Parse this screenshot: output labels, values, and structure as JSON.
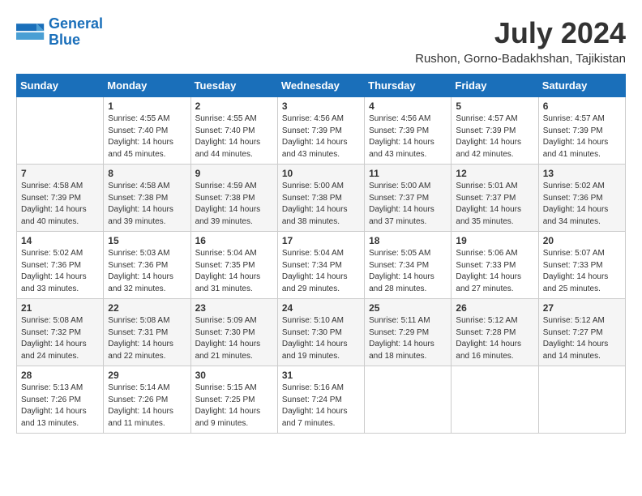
{
  "logo": {
    "line1": "General",
    "line2": "Blue"
  },
  "title": "July 2024",
  "location": "Rushon, Gorno-Badakhshan, Tajikistan",
  "headers": [
    "Sunday",
    "Monday",
    "Tuesday",
    "Wednesday",
    "Thursday",
    "Friday",
    "Saturday"
  ],
  "weeks": [
    [
      {
        "day": "",
        "sunrise": "",
        "sunset": "",
        "daylight": ""
      },
      {
        "day": "1",
        "sunrise": "Sunrise: 4:55 AM",
        "sunset": "Sunset: 7:40 PM",
        "daylight": "Daylight: 14 hours and 45 minutes."
      },
      {
        "day": "2",
        "sunrise": "Sunrise: 4:55 AM",
        "sunset": "Sunset: 7:40 PM",
        "daylight": "Daylight: 14 hours and 44 minutes."
      },
      {
        "day": "3",
        "sunrise": "Sunrise: 4:56 AM",
        "sunset": "Sunset: 7:39 PM",
        "daylight": "Daylight: 14 hours and 43 minutes."
      },
      {
        "day": "4",
        "sunrise": "Sunrise: 4:56 AM",
        "sunset": "Sunset: 7:39 PM",
        "daylight": "Daylight: 14 hours and 43 minutes."
      },
      {
        "day": "5",
        "sunrise": "Sunrise: 4:57 AM",
        "sunset": "Sunset: 7:39 PM",
        "daylight": "Daylight: 14 hours and 42 minutes."
      },
      {
        "day": "6",
        "sunrise": "Sunrise: 4:57 AM",
        "sunset": "Sunset: 7:39 PM",
        "daylight": "Daylight: 14 hours and 41 minutes."
      }
    ],
    [
      {
        "day": "7",
        "sunrise": "Sunrise: 4:58 AM",
        "sunset": "Sunset: 7:39 PM",
        "daylight": "Daylight: 14 hours and 40 minutes."
      },
      {
        "day": "8",
        "sunrise": "Sunrise: 4:58 AM",
        "sunset": "Sunset: 7:38 PM",
        "daylight": "Daylight: 14 hours and 39 minutes."
      },
      {
        "day": "9",
        "sunrise": "Sunrise: 4:59 AM",
        "sunset": "Sunset: 7:38 PM",
        "daylight": "Daylight: 14 hours and 39 minutes."
      },
      {
        "day": "10",
        "sunrise": "Sunrise: 5:00 AM",
        "sunset": "Sunset: 7:38 PM",
        "daylight": "Daylight: 14 hours and 38 minutes."
      },
      {
        "day": "11",
        "sunrise": "Sunrise: 5:00 AM",
        "sunset": "Sunset: 7:37 PM",
        "daylight": "Daylight: 14 hours and 37 minutes."
      },
      {
        "day": "12",
        "sunrise": "Sunrise: 5:01 AM",
        "sunset": "Sunset: 7:37 PM",
        "daylight": "Daylight: 14 hours and 35 minutes."
      },
      {
        "day": "13",
        "sunrise": "Sunrise: 5:02 AM",
        "sunset": "Sunset: 7:36 PM",
        "daylight": "Daylight: 14 hours and 34 minutes."
      }
    ],
    [
      {
        "day": "14",
        "sunrise": "Sunrise: 5:02 AM",
        "sunset": "Sunset: 7:36 PM",
        "daylight": "Daylight: 14 hours and 33 minutes."
      },
      {
        "day": "15",
        "sunrise": "Sunrise: 5:03 AM",
        "sunset": "Sunset: 7:36 PM",
        "daylight": "Daylight: 14 hours and 32 minutes."
      },
      {
        "day": "16",
        "sunrise": "Sunrise: 5:04 AM",
        "sunset": "Sunset: 7:35 PM",
        "daylight": "Daylight: 14 hours and 31 minutes."
      },
      {
        "day": "17",
        "sunrise": "Sunrise: 5:04 AM",
        "sunset": "Sunset: 7:34 PM",
        "daylight": "Daylight: 14 hours and 29 minutes."
      },
      {
        "day": "18",
        "sunrise": "Sunrise: 5:05 AM",
        "sunset": "Sunset: 7:34 PM",
        "daylight": "Daylight: 14 hours and 28 minutes."
      },
      {
        "day": "19",
        "sunrise": "Sunrise: 5:06 AM",
        "sunset": "Sunset: 7:33 PM",
        "daylight": "Daylight: 14 hours and 27 minutes."
      },
      {
        "day": "20",
        "sunrise": "Sunrise: 5:07 AM",
        "sunset": "Sunset: 7:33 PM",
        "daylight": "Daylight: 14 hours and 25 minutes."
      }
    ],
    [
      {
        "day": "21",
        "sunrise": "Sunrise: 5:08 AM",
        "sunset": "Sunset: 7:32 PM",
        "daylight": "Daylight: 14 hours and 24 minutes."
      },
      {
        "day": "22",
        "sunrise": "Sunrise: 5:08 AM",
        "sunset": "Sunset: 7:31 PM",
        "daylight": "Daylight: 14 hours and 22 minutes."
      },
      {
        "day": "23",
        "sunrise": "Sunrise: 5:09 AM",
        "sunset": "Sunset: 7:30 PM",
        "daylight": "Daylight: 14 hours and 21 minutes."
      },
      {
        "day": "24",
        "sunrise": "Sunrise: 5:10 AM",
        "sunset": "Sunset: 7:30 PM",
        "daylight": "Daylight: 14 hours and 19 minutes."
      },
      {
        "day": "25",
        "sunrise": "Sunrise: 5:11 AM",
        "sunset": "Sunset: 7:29 PM",
        "daylight": "Daylight: 14 hours and 18 minutes."
      },
      {
        "day": "26",
        "sunrise": "Sunrise: 5:12 AM",
        "sunset": "Sunset: 7:28 PM",
        "daylight": "Daylight: 14 hours and 16 minutes."
      },
      {
        "day": "27",
        "sunrise": "Sunrise: 5:12 AM",
        "sunset": "Sunset: 7:27 PM",
        "daylight": "Daylight: 14 hours and 14 minutes."
      }
    ],
    [
      {
        "day": "28",
        "sunrise": "Sunrise: 5:13 AM",
        "sunset": "Sunset: 7:26 PM",
        "daylight": "Daylight: 14 hours and 13 minutes."
      },
      {
        "day": "29",
        "sunrise": "Sunrise: 5:14 AM",
        "sunset": "Sunset: 7:26 PM",
        "daylight": "Daylight: 14 hours and 11 minutes."
      },
      {
        "day": "30",
        "sunrise": "Sunrise: 5:15 AM",
        "sunset": "Sunset: 7:25 PM",
        "daylight": "Daylight: 14 hours and 9 minutes."
      },
      {
        "day": "31",
        "sunrise": "Sunrise: 5:16 AM",
        "sunset": "Sunset: 7:24 PM",
        "daylight": "Daylight: 14 hours and 7 minutes."
      },
      {
        "day": "",
        "sunrise": "",
        "sunset": "",
        "daylight": ""
      },
      {
        "day": "",
        "sunrise": "",
        "sunset": "",
        "daylight": ""
      },
      {
        "day": "",
        "sunrise": "",
        "sunset": "",
        "daylight": ""
      }
    ]
  ]
}
